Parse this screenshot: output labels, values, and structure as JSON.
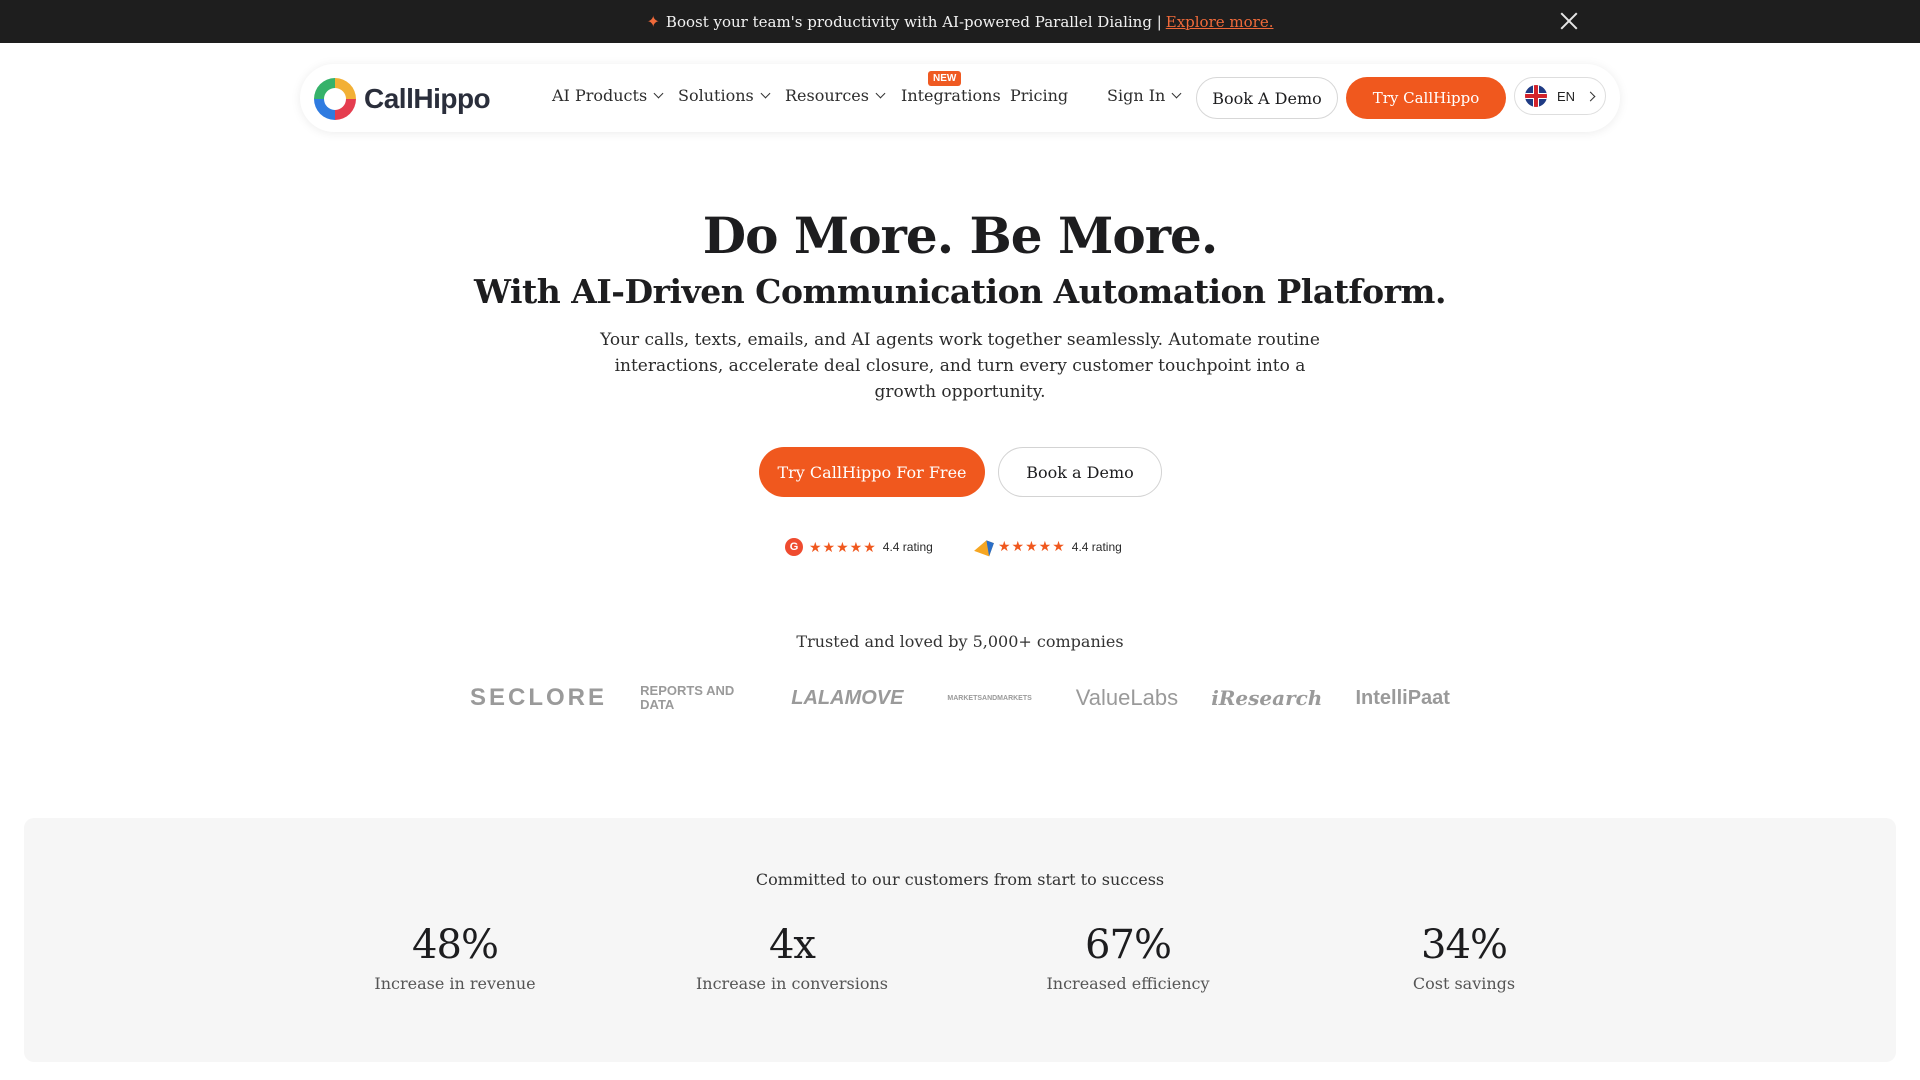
{
  "announcement": {
    "text": "Boost your team's productivity with AI-powered Parallel Dialing |",
    "link": "Explore more."
  },
  "nav": {
    "brand": "CallHippo",
    "items": [
      {
        "label": "AI Products",
        "badge": "NEW",
        "dropdown": true
      },
      {
        "label": "Solutions",
        "dropdown": true
      },
      {
        "label": "Resources",
        "dropdown": true
      },
      {
        "label": "Integrations",
        "dropdown": false
      },
      {
        "label": "Pricing",
        "dropdown": false
      }
    ],
    "sign_in": "Sign In",
    "book_demo": "Book A Demo",
    "try": "Try CallHippo",
    "language": "EN"
  },
  "hero": {
    "title": "Do More. Be More.",
    "subtitle": "With AI-Driven Communication Automation Platform.",
    "description": "Your calls, texts, emails, and AI agents work together seamlessly. Automate routine interactions, accelerate deal closure, and turn every customer touchpoint into a growth opportunity.",
    "cta_primary": "Try CallHippo For Free",
    "cta_secondary": "Book a Demo"
  },
  "ratings": [
    {
      "source_icon": "g2-icon",
      "stars": "★★★★★",
      "label": "4.4 rating"
    },
    {
      "source_icon": "capterra-icon",
      "stars": "★★★★★",
      "label": "4.4 rating"
    }
  ],
  "trusted": {
    "text": "Trusted and loved by 5,000+ companies",
    "logos": [
      "SECLORE",
      "REPORTS AND DATA",
      "LALAMOVE",
      "MARKETSANDMARKETS",
      "ValueLabs",
      "iResearch",
      "IntelliPaat"
    ]
  },
  "stats": {
    "heading": "Committed to our customers from start to success",
    "items": [
      {
        "value": "48%",
        "label": "Increase in revenue"
      },
      {
        "value": "4x",
        "label": "Increase in conversions"
      },
      {
        "value": "67%",
        "label": "Increased efficiency"
      },
      {
        "value": "34%",
        "label": "Cost savings"
      }
    ]
  },
  "colors": {
    "accent": "#f0581e",
    "announcement_bg": "#1e1e1e",
    "stats_bg": "#f6f6f6"
  }
}
